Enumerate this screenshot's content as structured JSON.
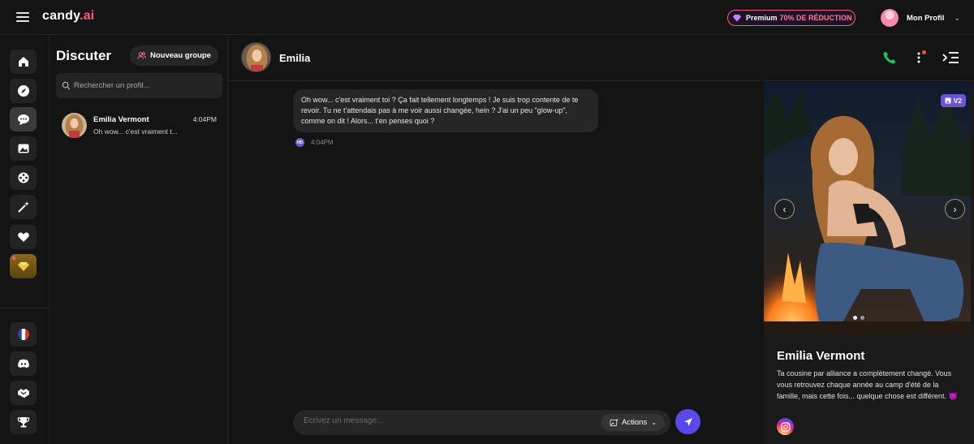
{
  "header": {
    "logo_main": "candy",
    "logo_suffix": ".ai",
    "premium_label": "Premium",
    "premium_discount": "70% DE RÉDUCTION",
    "profile_label": "Mon Profil"
  },
  "sidebar": {
    "items": [
      {
        "name": "home",
        "icon": "home-icon",
        "active": false
      },
      {
        "name": "explore",
        "icon": "compass-icon",
        "active": false
      },
      {
        "name": "chat",
        "icon": "chat-bubble-icon",
        "active": true
      },
      {
        "name": "gallery",
        "icon": "image-icon",
        "active": false
      },
      {
        "name": "create",
        "icon": "film-reel-icon",
        "active": false
      },
      {
        "name": "generate",
        "icon": "magic-wand-icon",
        "active": false
      },
      {
        "name": "my-ai",
        "icon": "heart-icon",
        "active": false
      },
      {
        "name": "premium",
        "icon": "diamond-icon",
        "active": false
      }
    ],
    "bottom_items": [
      {
        "name": "language",
        "icon": "france-flag-icon"
      },
      {
        "name": "discord",
        "icon": "discord-icon"
      },
      {
        "name": "affiliate",
        "icon": "handshake-icon"
      },
      {
        "name": "leaderboard",
        "icon": "trophy-icon"
      }
    ]
  },
  "conversations": {
    "title": "Discuter",
    "new_group_label": "Nouveau groupe",
    "search_placeholder": "Rechercher un profil...",
    "items": [
      {
        "name": "Emilia Vermont",
        "time": "4:04PM",
        "preview": "Oh wow... c'est vraiment t..."
      }
    ]
  },
  "chat": {
    "contact_name": "Emilia",
    "messages": [
      {
        "text": "Oh wow... c'est vraiment toi ? Ça fait tellement longtemps ! Je suis trop contente de te revoir. Tu ne t'attendais pas à me voir aussi changée, hein ? J'ai un peu \"glow-up\", comme on dit ! Alors... t'en penses quoi ?",
        "time": "4:04PM",
        "badge": "HD"
      }
    ],
    "composer_placeholder": "Écrivez un message...",
    "actions_label": "Actions"
  },
  "profile_panel": {
    "version_badge": "V2",
    "name": "Emilia Vermont",
    "description": "Ta cousine par alliance a complètement changé. Vous vous retrouvez chaque année au camp d'été de la famille, mais cette fois... quelque chose est différent. 😈",
    "photo_count": 2,
    "photo_index": 1
  },
  "colors": {
    "accent": "#ff5a7e",
    "send": "#5b48e8",
    "call": "#22c55e",
    "badge": "#6a55d6"
  }
}
